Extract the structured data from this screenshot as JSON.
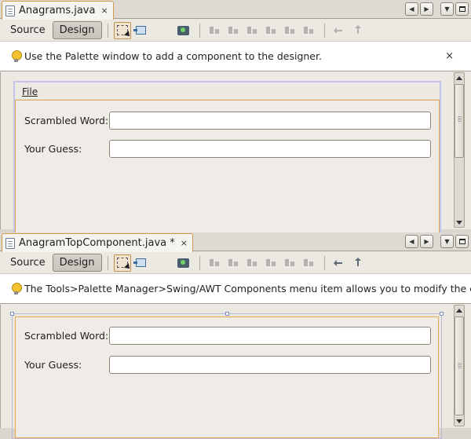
{
  "panels": [
    {
      "tab_title": "Anagrams.java",
      "tab_close": "×",
      "toolbar": {
        "source_label": "Source",
        "design_label": "Design",
        "active_view": "Design"
      },
      "hint": {
        "text": "Use the Palette window to add a component to the designer.",
        "close": "×"
      },
      "form": {
        "menu_file": "File",
        "fields": [
          {
            "label": "Scrambled Word:",
            "value": ""
          },
          {
            "label": "Your Guess:",
            "value": ""
          }
        ]
      }
    },
    {
      "tab_title": "AnagramTopComponent.java *",
      "tab_close": "×",
      "toolbar": {
        "source_label": "Source",
        "design_label": "Design",
        "active_view": "Design"
      },
      "hint": {
        "text": "The Tools>Palette Manager>Swing/AWT Components menu item allows you to modify the contents of the palette."
      },
      "form": {
        "fields": [
          {
            "label": "Scrambled Word:",
            "value": ""
          },
          {
            "label": "Your Guess:",
            "value": ""
          }
        ]
      }
    }
  ],
  "icons": {
    "toolbar": [
      "selection-mode-icon",
      "connection-mode-icon",
      "preview-design-icon",
      "align-left-icon",
      "align-right-icon",
      "center-horizontally-icon",
      "align-top-icon",
      "align-bottom-icon",
      "center-vertically-icon",
      "resize-horizontal-icon",
      "resize-vertical-icon"
    ],
    "window": [
      "scroll-left-icon",
      "scroll-right-icon",
      "show-documents-icon",
      "maximize-icon"
    ]
  },
  "colors": {
    "tab_highlight": "#d39a4c",
    "form_selection_border": "#e8a852"
  }
}
